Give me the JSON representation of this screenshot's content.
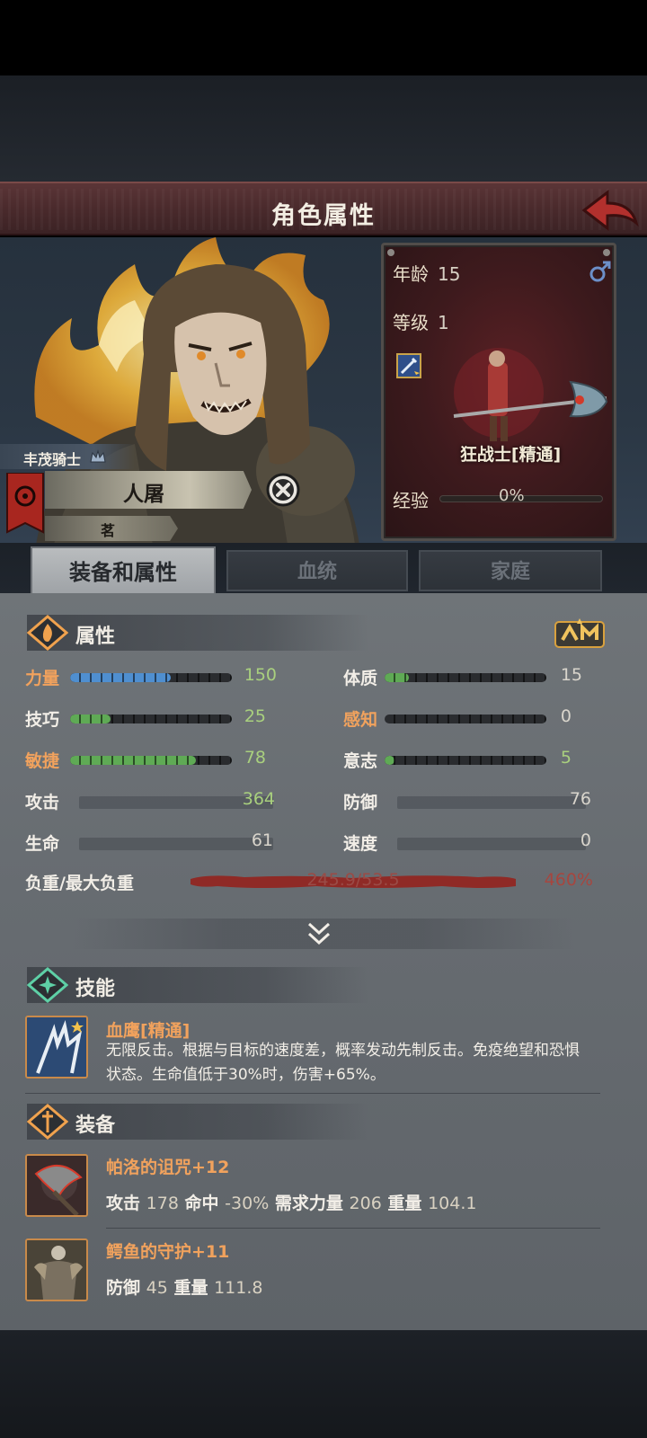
{
  "header": {
    "title": "角色属性"
  },
  "character": {
    "title_tag": "丰茂骑士",
    "name": "人屠",
    "sub_name": "茗",
    "age_label": "年龄",
    "age": "15",
    "level_label": "等级",
    "level": "1",
    "class_name": "狂战士[精通]",
    "exp_label": "经验",
    "exp_value": "0%",
    "exp_fraction": 0
  },
  "tabs": [
    {
      "label": "装备和属性",
      "active": true
    },
    {
      "label": "血统",
      "active": false
    },
    {
      "label": "家庭",
      "active": false
    }
  ],
  "attributes": {
    "section_label": "属性",
    "stats": [
      {
        "label": "力量",
        "value": "150",
        "fill": 0.62,
        "color": "#4f8fd0",
        "label_color": "orange",
        "value_color": "green"
      },
      {
        "label": "技巧",
        "value": "25",
        "fill": 0.25,
        "color": "#5faa55",
        "label_color": "white",
        "value_color": "green"
      },
      {
        "label": "敏捷",
        "value": "78",
        "fill": 0.78,
        "color": "#5faa55",
        "label_color": "orange",
        "value_color": "green"
      },
      {
        "label": "体质",
        "value": "15",
        "fill": 0.15,
        "color": "#5faa55",
        "label_color": "white",
        "value_color": "gray"
      },
      {
        "label": "感知",
        "value": "0",
        "fill": 0,
        "color": "#5faa55",
        "label_color": "orange",
        "value_color": "gray"
      },
      {
        "label": "意志",
        "value": "5",
        "fill": 0.06,
        "color": "#5faa55",
        "label_color": "white",
        "value_color": "green"
      }
    ],
    "derived": [
      {
        "label": "攻击",
        "value": "364",
        "value_color": "green"
      },
      {
        "label": "防御",
        "value": "76",
        "value_color": "gray"
      },
      {
        "label": "生命",
        "value": "61",
        "value_color": "gray"
      },
      {
        "label": "速度",
        "value": "0",
        "value_color": "gray"
      }
    ],
    "load_label": "负重/最大负重",
    "load_value": "245.9/53.5",
    "load_percent": "460%"
  },
  "skills": {
    "section_label": "技能",
    "items": [
      {
        "name": "血鹰[精通]",
        "desc_line1": "无限反击。根据与目标的速度差，概率发动先制反击。免疫绝望和恐惧",
        "desc_line2": "状态。生命值低于30%时，伤害+65%。"
      }
    ]
  },
  "equipment": {
    "section_label": "装备",
    "items": [
      {
        "name": "帕洛的诅咒+12",
        "s1_label": "攻击",
        "s1_val": "178",
        "s2_label": "命中",
        "s2_val": "-30%",
        "s3_label": "需求力量",
        "s3_val": "206",
        "s4_label": "重量",
        "s4_val": "104.1"
      },
      {
        "name": "鳄鱼的守护+11",
        "s1_label": "防御",
        "s1_val": "45",
        "s2_label": "重量",
        "s2_val": "111.8"
      }
    ]
  },
  "colors": {
    "accent_orange": "#f1a25d",
    "value_green": "#a9d07e",
    "load_red": "#a6463f",
    "header_maroon": "#4a2a2c"
  }
}
